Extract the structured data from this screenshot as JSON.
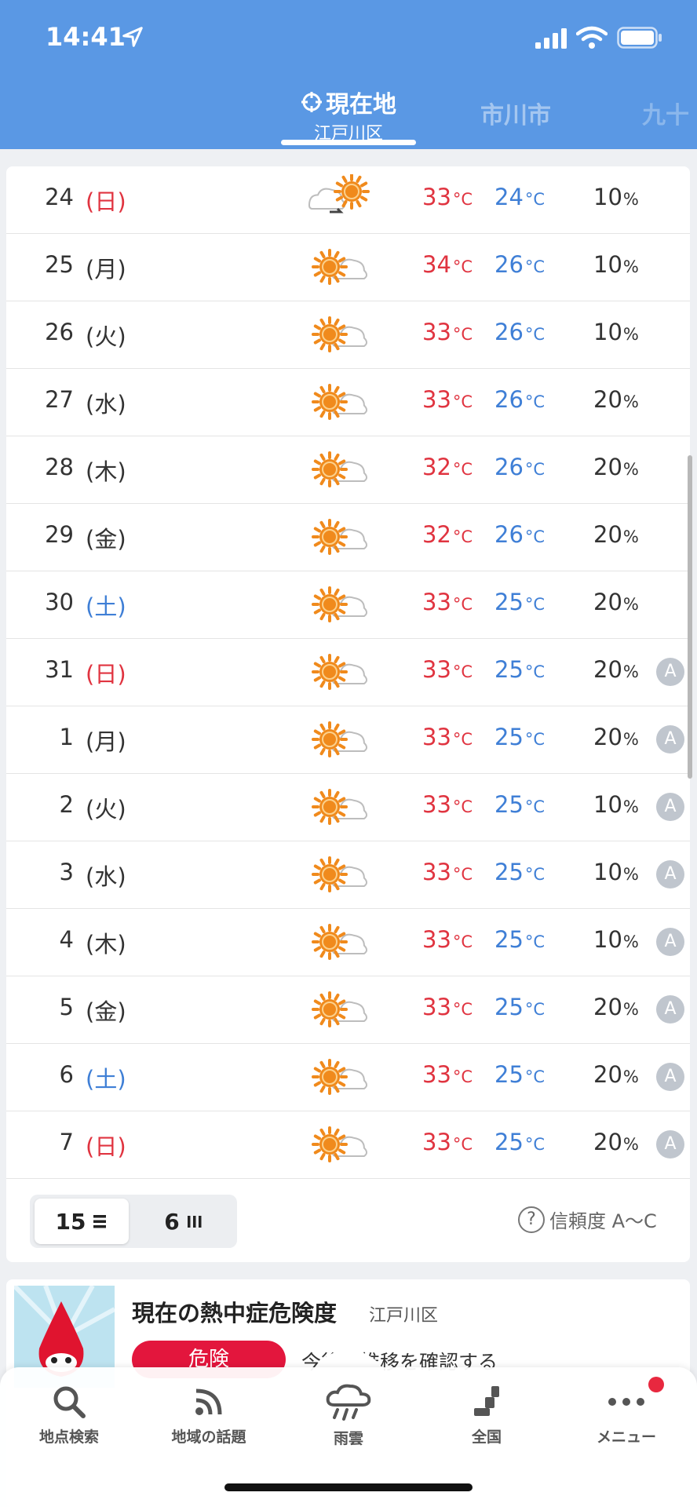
{
  "status_bar": {
    "time": "14:41"
  },
  "tabs": {
    "current_label": "現在地",
    "current_sub": "江戸川区",
    "second": "市川市",
    "third": "九十"
  },
  "forecast": [
    {
      "day": "24",
      "dow": "(日)",
      "dow_type": "sun",
      "weather": "cloudy-sunny",
      "hi": "33",
      "lo": "24",
      "pop": "10",
      "reliability": ""
    },
    {
      "day": "25",
      "dow": "(月)",
      "dow_type": "weekday",
      "weather": "sunny-cloudy",
      "hi": "34",
      "lo": "26",
      "pop": "10",
      "reliability": ""
    },
    {
      "day": "26",
      "dow": "(火)",
      "dow_type": "weekday",
      "weather": "sunny-cloudy",
      "hi": "33",
      "lo": "26",
      "pop": "10",
      "reliability": ""
    },
    {
      "day": "27",
      "dow": "(水)",
      "dow_type": "weekday",
      "weather": "sunny-cloudy",
      "hi": "33",
      "lo": "26",
      "pop": "20",
      "reliability": ""
    },
    {
      "day": "28",
      "dow": "(木)",
      "dow_type": "weekday",
      "weather": "sunny-cloudy",
      "hi": "32",
      "lo": "26",
      "pop": "20",
      "reliability": ""
    },
    {
      "day": "29",
      "dow": "(金)",
      "dow_type": "weekday",
      "weather": "sunny-cloudy",
      "hi": "32",
      "lo": "26",
      "pop": "20",
      "reliability": ""
    },
    {
      "day": "30",
      "dow": "(土)",
      "dow_type": "sat",
      "weather": "sunny-cloudy",
      "hi": "33",
      "lo": "25",
      "pop": "20",
      "reliability": ""
    },
    {
      "day": "31",
      "dow": "(日)",
      "dow_type": "sun",
      "weather": "sunny-cloudy",
      "hi": "33",
      "lo": "25",
      "pop": "20",
      "reliability": "A"
    },
    {
      "day": "1",
      "dow": "(月)",
      "dow_type": "weekday",
      "weather": "sunny-cloudy",
      "hi": "33",
      "lo": "25",
      "pop": "20",
      "reliability": "A"
    },
    {
      "day": "2",
      "dow": "(火)",
      "dow_type": "weekday",
      "weather": "sunny-cloudy",
      "hi": "33",
      "lo": "25",
      "pop": "10",
      "reliability": "A"
    },
    {
      "day": "3",
      "dow": "(水)",
      "dow_type": "weekday",
      "weather": "sunny-cloudy",
      "hi": "33",
      "lo": "25",
      "pop": "10",
      "reliability": "A"
    },
    {
      "day": "4",
      "dow": "(木)",
      "dow_type": "weekday",
      "weather": "sunny-cloudy",
      "hi": "33",
      "lo": "25",
      "pop": "10",
      "reliability": "A"
    },
    {
      "day": "5",
      "dow": "(金)",
      "dow_type": "weekday",
      "weather": "sunny-cloudy",
      "hi": "33",
      "lo": "25",
      "pop": "20",
      "reliability": "A"
    },
    {
      "day": "6",
      "dow": "(土)",
      "dow_type": "sat",
      "weather": "sunny-cloudy",
      "hi": "33",
      "lo": "25",
      "pop": "20",
      "reliability": "A"
    },
    {
      "day": "7",
      "dow": "(日)",
      "dow_type": "sun",
      "weather": "sunny-cloudy",
      "hi": "33",
      "lo": "25",
      "pop": "20",
      "reliability": "A"
    }
  ],
  "units": {
    "temp": "°C",
    "pop": "%"
  },
  "toggle": {
    "days15": "15",
    "days6": "6"
  },
  "reliability_label": "信頼度 A～C",
  "heat": {
    "title": "現在の熱中症危険度",
    "area": "江戸川区",
    "level": "危険",
    "trend_link": "今後の推移を確認する"
  },
  "nav": {
    "search": "地点検索",
    "topics": "地域の話題",
    "rain": "雨雲",
    "national": "全国",
    "menu": "メニュー"
  },
  "colors": {
    "header": "#5a98e4",
    "high_temp": "#e03440",
    "low_temp": "#3f7fd6",
    "danger": "#e3163d",
    "sun": "#f08a1c"
  }
}
